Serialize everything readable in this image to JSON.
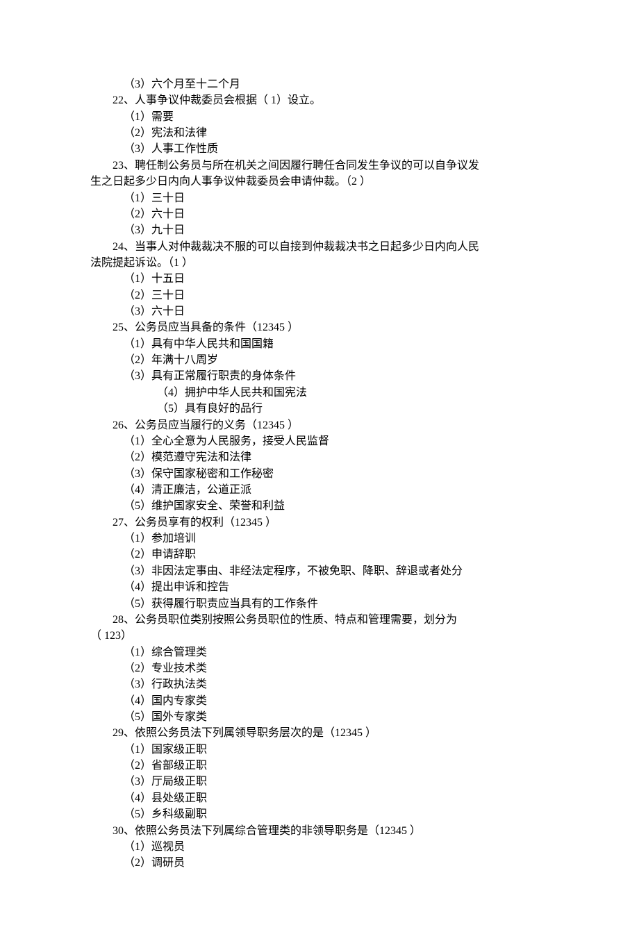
{
  "lines": [
    {
      "cls": "indent2",
      "text": "（3）六个月至十二个月"
    },
    {
      "cls": "indent1",
      "text": "22、人事争议仲裁委员会根据（ 1）设立。"
    },
    {
      "cls": "indent2",
      "text": "（1）需要"
    },
    {
      "cls": "indent2",
      "text": "（2）宪法和法律"
    },
    {
      "cls": "indent2",
      "text": "（3）人事工作性质"
    },
    {
      "cls": "wrap",
      "first": "23、聘任制公务员与所在机关之间因履行聘任合同发生争议的可以自争议发",
      "cont": "生之日起多少日内向人事争议仲裁委员会申请仲裁。（2 ）"
    },
    {
      "cls": "indent2",
      "text": "（1）三十日"
    },
    {
      "cls": "indent2",
      "text": "（2）六十日"
    },
    {
      "cls": "indent2",
      "text": "（3）九十日"
    },
    {
      "cls": "wrap",
      "first": "24、当事人对仲裁裁决不服的可以自接到仲裁裁决书之日起多少日内向人民",
      "cont": "法院提起诉讼。（1 ）"
    },
    {
      "cls": "indent2",
      "text": "（1）十五日"
    },
    {
      "cls": "indent2",
      "text": "（2）三十日"
    },
    {
      "cls": "indent2",
      "text": "（3）六十日"
    },
    {
      "cls": "indent1",
      "text": "25、公务员应当具备的条件（12345 ）"
    },
    {
      "cls": "indent2",
      "text": "（1）具有中华人民共和国国籍"
    },
    {
      "cls": "indent2",
      "text": "（2）年满十八周岁"
    },
    {
      "cls": "indent2",
      "text": "（3）具有正常履行职责的身体条件"
    },
    {
      "cls": "indent3",
      "text": "（4）拥护中华人民共和国宪法"
    },
    {
      "cls": "indent3",
      "text": "（5）具有良好的品行"
    },
    {
      "cls": "indent1",
      "text": "26、公务员应当履行的义务（12345 ）"
    },
    {
      "cls": "indent2",
      "text": "（1）全心全意为人民服务，接受人民监督"
    },
    {
      "cls": "indent2",
      "text": "（2）模范遵守宪法和法律"
    },
    {
      "cls": "indent2",
      "text": "（3）保守国家秘密和工作秘密"
    },
    {
      "cls": "indent2",
      "text": "（4）清正廉洁，公道正派"
    },
    {
      "cls": "indent2",
      "text": "（5）维护国家安全、荣誉和利益"
    },
    {
      "cls": "indent1",
      "text": "27、公务员享有的权利（12345 ）"
    },
    {
      "cls": "indent2",
      "text": "（1）参加培训"
    },
    {
      "cls": "indent2",
      "text": "（2）申请辞职"
    },
    {
      "cls": "indent2",
      "text": "（3）非因法定事由、非经法定程序，不被免职、降职、辞退或者处分"
    },
    {
      "cls": "indent2",
      "text": "（4）提出申诉和控告"
    },
    {
      "cls": "indent2",
      "text": "（5）获得履行职责应当具有的工作条件"
    },
    {
      "cls": "wrap",
      "first": "28、公务员职位类别按照公务员职位的性质、特点和管理需要，划分为",
      "cont": "（ 123）"
    },
    {
      "cls": "indent2",
      "text": "（1）综合管理类"
    },
    {
      "cls": "indent2",
      "text": "（2）专业技术类"
    },
    {
      "cls": "indent2",
      "text": "（3）行政执法类"
    },
    {
      "cls": "indent2",
      "text": "（4）国内专家类"
    },
    {
      "cls": "indent2",
      "text": "（5）国外专家类"
    },
    {
      "cls": "indent1",
      "text": "29、依照公务员法下列属领导职务层次的是（12345 ）"
    },
    {
      "cls": "indent2",
      "text": "（1）国家级正职"
    },
    {
      "cls": "indent2",
      "text": "（2）省部级正职"
    },
    {
      "cls": "indent2",
      "text": "（3）厅局级正职"
    },
    {
      "cls": "indent2",
      "text": "（4）县处级正职"
    },
    {
      "cls": "indent2",
      "text": "（5）乡科级副职"
    },
    {
      "cls": "indent1",
      "text": "30、依照公务员法下列属综合管理类的非领导职务是（12345 ）"
    },
    {
      "cls": "indent2",
      "text": "（1）巡视员"
    },
    {
      "cls": "indent2",
      "text": "（2）调研员"
    }
  ]
}
